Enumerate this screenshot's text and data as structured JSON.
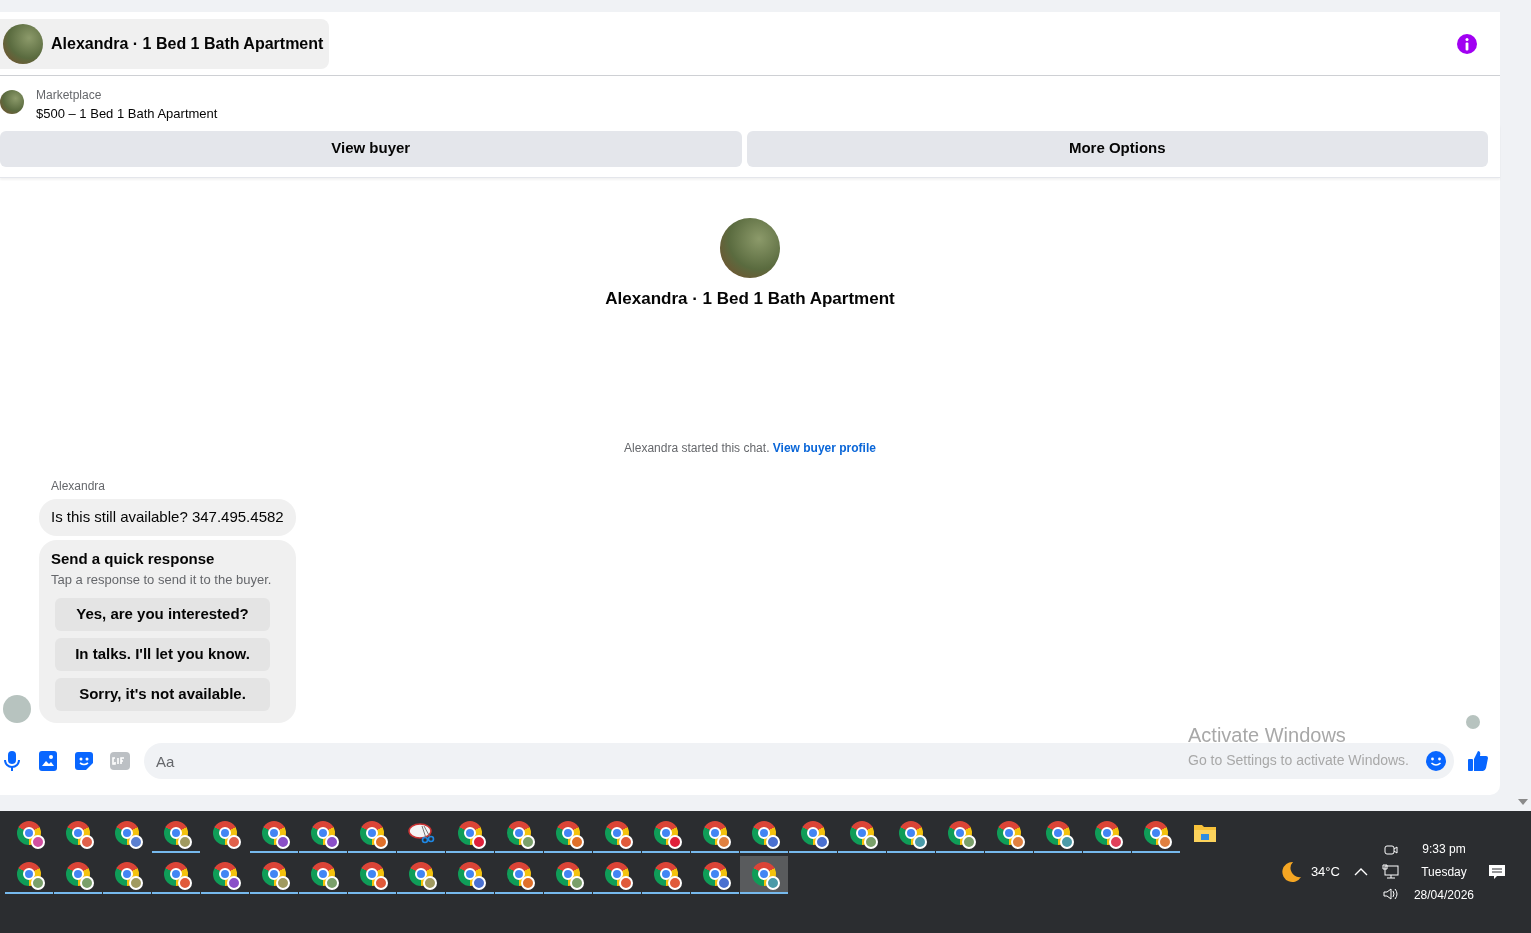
{
  "conversation": {
    "title": "Alexandra · 1 Bed 1 Bath Apartment"
  },
  "listing": {
    "source": "Marketplace",
    "summary": "$500 – 1 Bed 1 Bath Apartment"
  },
  "actions": [
    "View buyer",
    "More Options"
  ],
  "intro": {
    "title": "Alexandra · 1 Bed 1 Bath Apartment",
    "notice": "Alexandra started this chat.",
    "link": "View buyer profile"
  },
  "messages": [
    {
      "sender": "Alexandra",
      "text": "Is this still available? 347.495.4582"
    }
  ],
  "quick_response": {
    "title": "Send a quick response",
    "hint": "Tap a response to send it to the buyer.",
    "options": [
      "Yes, are you interested?",
      "In talks. I'll let you know.",
      "Sorry, it's not available."
    ]
  },
  "composer": {
    "placeholder": "Aa"
  },
  "activation_notice": {
    "title": "Activate Windows",
    "text": "Go to Settings to activate Windows."
  },
  "taskbar": {
    "rows": [
      [
        {
          "kind": "browser",
          "color": "#d04fa0",
          "running": false,
          "selected": false
        },
        {
          "kind": "browser",
          "color": "#e0604a",
          "running": false,
          "selected": false
        },
        {
          "kind": "browser",
          "color": "#5a7fd0",
          "running": false,
          "selected": false
        },
        {
          "kind": "browser",
          "color": "#a09a60",
          "running": true,
          "selected": false
        },
        {
          "kind": "browser",
          "color": "#e0604a",
          "running": false,
          "selected": false
        },
        {
          "kind": "browser",
          "color": "#8a4fc8",
          "running": true,
          "selected": false
        },
        {
          "kind": "browser",
          "color": "#8a4fc8",
          "running": true,
          "selected": false
        },
        {
          "kind": "browser",
          "color": "#e0702a",
          "running": true,
          "selected": false
        },
        {
          "kind": "snip",
          "running": true,
          "selected": false
        },
        {
          "kind": "browser",
          "color": "#e0203a",
          "running": true,
          "selected": false
        },
        {
          "kind": "browser",
          "color": "#7aa06a",
          "running": true,
          "selected": false
        },
        {
          "kind": "browser",
          "color": "#e0702a",
          "running": true,
          "selected": false
        },
        {
          "kind": "browser",
          "color": "#e05a3a",
          "running": true,
          "selected": false
        },
        {
          "kind": "browser",
          "color": "#e0203a",
          "running": true,
          "selected": false
        },
        {
          "kind": "browser",
          "color": "#e08040",
          "running": true,
          "selected": false
        },
        {
          "kind": "browser",
          "color": "#4a70d0",
          "running": true,
          "selected": false
        },
        {
          "kind": "browser",
          "color": "#4a70d0",
          "running": true,
          "selected": false
        },
        {
          "kind": "browser",
          "color": "#7aa06a",
          "running": true,
          "selected": false
        },
        {
          "kind": "browser",
          "color": "#4a9aa8",
          "running": true,
          "selected": false
        },
        {
          "kind": "browser",
          "color": "#7aa06a",
          "running": true,
          "selected": false
        },
        {
          "kind": "browser",
          "color": "#e08040",
          "running": true,
          "selected": false
        },
        {
          "kind": "browser",
          "color": "#4a9aa8",
          "running": true,
          "selected": false
        },
        {
          "kind": "browser",
          "color": "#e0405a",
          "running": true,
          "selected": false
        },
        {
          "kind": "browser",
          "color": "#e08040",
          "running": true,
          "selected": false
        },
        {
          "kind": "folder",
          "running": false,
          "selected": false
        }
      ],
      [
        {
          "kind": "browser",
          "color": "#7aa06a",
          "running": true,
          "selected": false
        },
        {
          "kind": "browser",
          "color": "#7aa06a",
          "running": true,
          "selected": false
        },
        {
          "kind": "browser",
          "color": "#a09a60",
          "running": true,
          "selected": false
        },
        {
          "kind": "browser",
          "color": "#e05a3a",
          "running": true,
          "selected": false
        },
        {
          "kind": "browser",
          "color": "#8a4fc8",
          "running": true,
          "selected": false
        },
        {
          "kind": "browser",
          "color": "#a09a60",
          "running": true,
          "selected": false
        },
        {
          "kind": "browser",
          "color": "#7aa06a",
          "running": true,
          "selected": false
        },
        {
          "kind": "browser",
          "color": "#e05a3a",
          "running": true,
          "selected": false
        },
        {
          "kind": "browser",
          "color": "#a09a60",
          "running": true,
          "selected": false
        },
        {
          "kind": "browser",
          "color": "#4a70d0",
          "running": true,
          "selected": false
        },
        {
          "kind": "browser",
          "color": "#e0702a",
          "running": true,
          "selected": false
        },
        {
          "kind": "browser",
          "color": "#7aa06a",
          "running": true,
          "selected": false
        },
        {
          "kind": "browser",
          "color": "#e05a3a",
          "running": true,
          "selected": false
        },
        {
          "kind": "browser",
          "color": "#e05a3a",
          "running": true,
          "selected": false
        },
        {
          "kind": "browser",
          "color": "#4a70d0",
          "running": true,
          "selected": false
        },
        {
          "kind": "browser",
          "color": "#4a9aa8",
          "running": true,
          "selected": true
        }
      ]
    ],
    "tray": {
      "temperature": "34°C",
      "time": "9:33 pm",
      "day": "Tuesday",
      "date": "28/04/2026"
    }
  }
}
